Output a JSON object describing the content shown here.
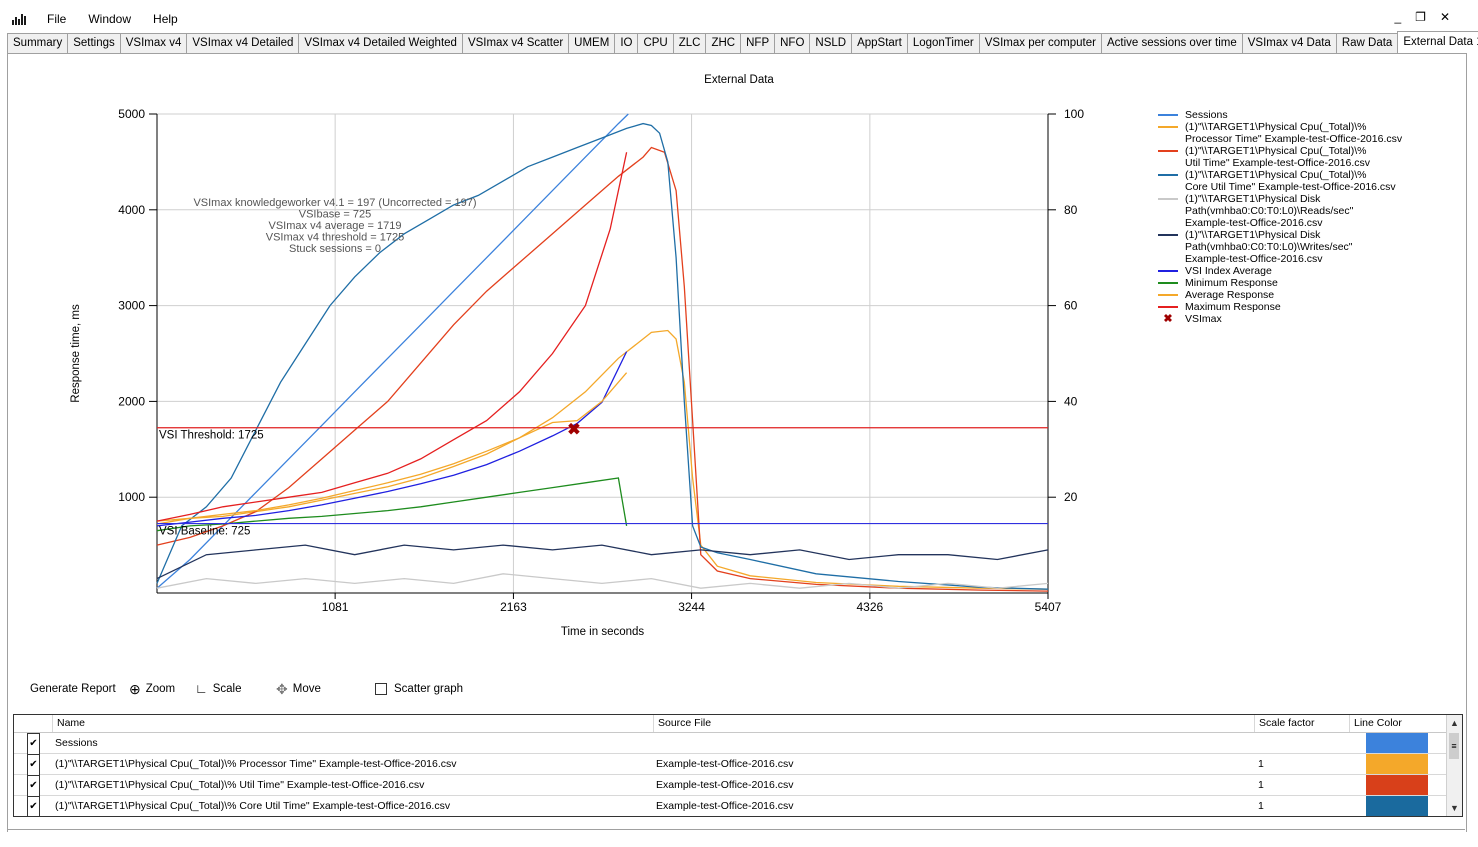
{
  "menu": {
    "items": [
      "File",
      "Window",
      "Help"
    ],
    "window_controls": [
      "_",
      "❐",
      "✕"
    ]
  },
  "tabs": [
    "Summary",
    "Settings",
    "VSImax v4",
    "VSImax v4 Detailed",
    "VSImax v4 Detailed Weighted",
    "VSImax v4 Scatter",
    "UMEM",
    "IO",
    "CPU",
    "ZLC",
    "ZHC",
    "NFP",
    "NFO",
    "NSLD",
    "AppStart",
    "LogonTimer",
    "VSImax per computer",
    "Active sessions over time",
    "VSImax v4 Data",
    "Raw Data",
    "External Data 1"
  ],
  "active_tab": "External Data 1",
  "chart_data": {
    "type": "line",
    "title": "External Data",
    "xlabel": "Time in seconds",
    "ylabel": "Response time, ms",
    "x_ticks": [
      "1081",
      "2163",
      "3244",
      "4326",
      "5407"
    ],
    "y_left_ticks": [
      "1000",
      "2000",
      "3000",
      "4000",
      "5000"
    ],
    "y_right_ticks": [
      "20",
      "40",
      "60",
      "80",
      "100"
    ],
    "xlim": [
      0,
      5407
    ],
    "ylim_left": [
      0,
      5000
    ],
    "ylim_right": [
      0,
      100
    ],
    "grid": true,
    "legend_position": "right",
    "annotations": [
      "VSImax knowledgeworker v4.1 = 197 (Uncorrected = 197)",
      "VSIbase = 725",
      "VSImax v4 average = 1719",
      "VSImax v4 threshold = 1725",
      "Stuck sessions = 0"
    ],
    "reference_lines": [
      {
        "label": "VSI Threshold: 1725",
        "value": 1725,
        "color": "#e02020"
      },
      {
        "label": "VSI Baseline: 725",
        "value": 725,
        "color": "#3030e0"
      }
    ],
    "vsimax_marker": {
      "x": 2530,
      "y": 1719
    },
    "series": [
      {
        "name": "Sessions",
        "color": "#3c82dc",
        "axis": "right",
        "x": [
          0,
          200,
          400,
          600,
          800,
          1000,
          1200,
          1400,
          1600,
          1800,
          2000,
          2200,
          2400,
          2600,
          2800,
          2860
        ],
        "y": [
          1,
          7,
          14,
          21,
          28,
          35,
          42,
          49,
          56,
          63,
          70,
          77,
          84,
          91,
          98,
          100
        ]
      },
      {
        "name": "(1)\"\\\\TARGET1\\Physical Cpu(_Total)\\% Processor Time\" Example-test-Office-2016.csv",
        "color": "#f4a82a",
        "axis": "left",
        "x": [
          0,
          200,
          400,
          600,
          800,
          1000,
          1200,
          1400,
          1600,
          1800,
          2000,
          2200,
          2400,
          2600,
          2800,
          3000,
          3100,
          3150,
          3200,
          3250,
          3300,
          3400,
          3600,
          4000,
          4500,
          5000,
          5407
        ],
        "y": [
          750,
          780,
          800,
          850,
          900,
          970,
          1040,
          1110,
          1200,
          1320,
          1450,
          1620,
          1830,
          2100,
          2450,
          2720,
          2740,
          2650,
          2200,
          1200,
          500,
          280,
          180,
          110,
          70,
          50,
          40
        ]
      },
      {
        "name": "(1)\"\\\\TARGET1\\Physical Cpu(_Total)\\% Util Time\" Example-test-Office-2016.csv",
        "color": "#e3401d",
        "axis": "left",
        "x": [
          0,
          200,
          400,
          600,
          800,
          1000,
          1200,
          1400,
          1600,
          1800,
          2000,
          2200,
          2400,
          2600,
          2800,
          2950,
          3000,
          3080,
          3150,
          3200,
          3250,
          3300,
          3400,
          3600,
          4000,
          4500,
          5000,
          5407
        ],
        "y": [
          500,
          580,
          700,
          850,
          1100,
          1400,
          1700,
          2000,
          2400,
          2800,
          3150,
          3450,
          3750,
          4050,
          4350,
          4550,
          4650,
          4600,
          4200,
          3200,
          1800,
          400,
          230,
          150,
          90,
          50,
          30,
          20
        ]
      },
      {
        "name": "(1)\"\\\\TARGET1\\Physical Cpu(_Total)\\% Core Util Time\" Example-test-Office-2016.csv",
        "color": "#1f6ea6",
        "axis": "left",
        "x": [
          0,
          150,
          300,
          450,
          600,
          750,
          900,
          1050,
          1200,
          1350,
          1500,
          1650,
          1800,
          1950,
          2100,
          2250,
          2400,
          2550,
          2700,
          2850,
          2950,
          3000,
          3050,
          3100,
          3150,
          3200,
          3250,
          3300,
          3400,
          3600,
          4000,
          4500,
          5000,
          5407
        ],
        "y": [
          100,
          700,
          900,
          1200,
          1700,
          2200,
          2600,
          3000,
          3300,
          3550,
          3750,
          3900,
          4050,
          4150,
          4300,
          4450,
          4550,
          4650,
          4750,
          4850,
          4900,
          4880,
          4800,
          4500,
          3500,
          2000,
          700,
          480,
          420,
          350,
          200,
          120,
          60,
          40
        ]
      },
      {
        "name": "(1)\"\\\\TARGET1\\Physical Disk Path(vmhba0:C0:T0:L0)\\Reads/sec\" Example-test-Office-2016.csv",
        "color": "#c9c9c9",
        "axis": "right",
        "x": [
          0,
          300,
          600,
          900,
          1200,
          1500,
          1800,
          2100,
          2400,
          2700,
          3000,
          3300,
          3600,
          3900,
          4200,
          4500,
          4800,
          5100,
          5407
        ],
        "y": [
          1,
          3,
          2,
          3,
          2,
          3,
          2,
          4,
          3,
          2,
          3,
          1,
          2,
          1,
          2,
          1,
          2,
          1,
          2
        ]
      },
      {
        "name": "(1)\"\\\\TARGET1\\Physical Disk Path(vmhba0:C0:T0:L0)\\Writes/sec\" Example-test-Office-2016.csv",
        "color": "#23345c",
        "axis": "right",
        "x": [
          0,
          300,
          600,
          900,
          1200,
          1500,
          1800,
          2100,
          2400,
          2700,
          3000,
          3300,
          3600,
          3900,
          4200,
          4500,
          4800,
          5100,
          5407
        ],
        "y": [
          3,
          8,
          9,
          10,
          8,
          10,
          9,
          10,
          9,
          10,
          8,
          9,
          8,
          9,
          7,
          8,
          8,
          7,
          9
        ]
      },
      {
        "name": "VSI Index Average",
        "color": "#2020e0",
        "axis": "left",
        "x": [
          0,
          200,
          400,
          600,
          800,
          1000,
          1200,
          1400,
          1600,
          1800,
          2000,
          2200,
          2400,
          2550,
          2700,
          2850
        ],
        "y": [
          700,
          740,
          780,
          810,
          860,
          920,
          990,
          1060,
          1140,
          1230,
          1340,
          1480,
          1640,
          1770,
          1990,
          2520
        ]
      },
      {
        "name": "Minimum Response",
        "color": "#1e8c1e",
        "axis": "left",
        "x": [
          0,
          200,
          400,
          600,
          800,
          1000,
          1200,
          1400,
          1600,
          1800,
          2000,
          2200,
          2400,
          2600,
          2800,
          2850
        ],
        "y": [
          650,
          700,
          720,
          750,
          780,
          800,
          830,
          860,
          900,
          950,
          1000,
          1050,
          1100,
          1150,
          1200,
          700
        ]
      },
      {
        "name": "Average Response",
        "color": "#f4a82a",
        "axis": "left",
        "x": [
          0,
          200,
          400,
          600,
          800,
          1000,
          1200,
          1400,
          1600,
          1800,
          2000,
          2200,
          2400,
          2550,
          2700,
          2850
        ],
        "y": [
          720,
          780,
          820,
          860,
          920,
          990,
          1070,
          1150,
          1240,
          1350,
          1480,
          1620,
          1780,
          1800,
          2000,
          2300
        ]
      },
      {
        "name": "Maximum Response",
        "color": "#e52020",
        "axis": "left",
        "x": [
          0,
          200,
          400,
          600,
          800,
          1000,
          1200,
          1400,
          1600,
          1800,
          2000,
          2200,
          2400,
          2600,
          2750,
          2850
        ],
        "y": [
          750,
          820,
          900,
          950,
          1000,
          1050,
          1150,
          1250,
          1400,
          1600,
          1800,
          2100,
          2500,
          3000,
          3800,
          4600
        ]
      }
    ],
    "legend": [
      {
        "label": "Sessions",
        "color": "#3c82dc",
        "kind": "line"
      },
      {
        "label": "(1)\"\\\\TARGET1\\Physical Cpu(_Total)\\%\nProcessor Time\" Example-test-Office-2016.csv",
        "color": "#f4a82a",
        "kind": "line"
      },
      {
        "label": "(1)\"\\\\TARGET1\\Physical Cpu(_Total)\\%\nUtil Time\" Example-test-Office-2016.csv",
        "color": "#e3401d",
        "kind": "line"
      },
      {
        "label": "(1)\"\\\\TARGET1\\Physical Cpu(_Total)\\%\nCore Util Time\" Example-test-Office-2016.csv",
        "color": "#1f6ea6",
        "kind": "line"
      },
      {
        "label": "(1)\"\\\\TARGET1\\Physical Disk\nPath(vmhba0:C0:T0:L0)\\Reads/sec\"\nExample-test-Office-2016.csv",
        "color": "#c9c9c9",
        "kind": "line"
      },
      {
        "label": "(1)\"\\\\TARGET1\\Physical Disk\nPath(vmhba0:C0:T0:L0)\\Writes/sec\"\nExample-test-Office-2016.csv",
        "color": "#23345c",
        "kind": "line"
      },
      {
        "label": "VSI Index Average",
        "color": "#2020e0",
        "kind": "line"
      },
      {
        "label": "Minimum Response",
        "color": "#1e8c1e",
        "kind": "line"
      },
      {
        "label": "Average Response",
        "color": "#f4a82a",
        "kind": "line"
      },
      {
        "label": "Maximum Response",
        "color": "#e52020",
        "kind": "line"
      },
      {
        "label": "VSImax",
        "color": "#a00000",
        "kind": "marker"
      }
    ]
  },
  "toolbar": {
    "generate_report": "Generate Report",
    "zoom": "Zoom",
    "scale": "Scale",
    "move": "Move",
    "scatter_graph": "Scatter graph"
  },
  "grid": {
    "headers": [
      "Name",
      "Source File",
      "Scale factor",
      "Line Color"
    ],
    "rows": [
      {
        "name": "Sessions",
        "source": "",
        "scale": "",
        "color": "#3c82dc",
        "checked": true
      },
      {
        "name": "(1)\"\\\\TARGET1\\Physical Cpu(_Total)\\% Processor Time\" Example-test-Office-2016.csv",
        "source": "Example-test-Office-2016.csv",
        "scale": "1",
        "color": "#f4a82a",
        "checked": true
      },
      {
        "name": "(1)\"\\\\TARGET1\\Physical Cpu(_Total)\\% Util Time\" Example-test-Office-2016.csv",
        "source": "Example-test-Office-2016.csv",
        "scale": "1",
        "color": "#d8401a",
        "checked": true
      },
      {
        "name": "(1)\"\\\\TARGET1\\Physical Cpu(_Total)\\% Core Util Time\" Example-test-Office-2016.csv",
        "source": "Example-test-Office-2016.csv",
        "scale": "1",
        "color": "#1a6a9e",
        "checked": true
      }
    ]
  }
}
